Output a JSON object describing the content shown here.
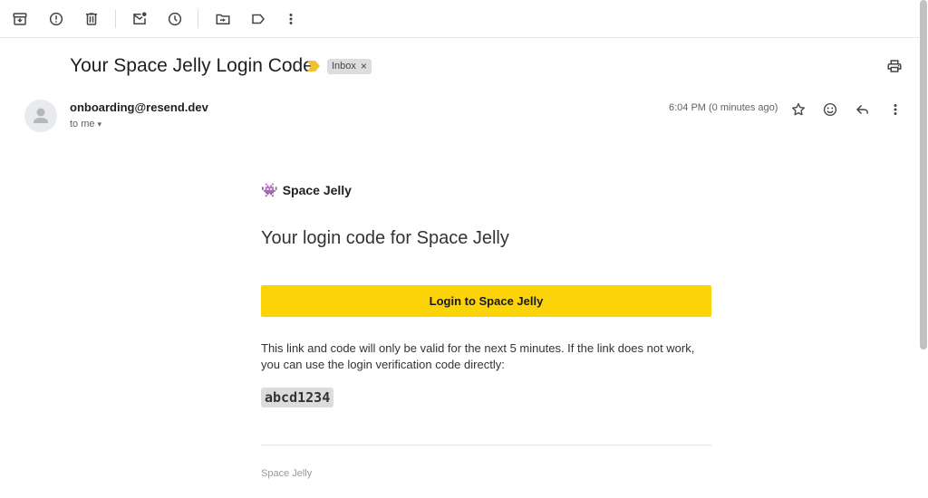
{
  "subject": "Your Space Jelly Login Code",
  "label": "Inbox",
  "label_close": "×",
  "sender": "onboarding@resend.dev",
  "recipient": "to me",
  "recipient_caret": "▾",
  "timestamp": "6:04 PM (0 minutes ago)",
  "email": {
    "brand_emoji": "👾",
    "brand": "Space Jelly",
    "heading": "Your login code for Space Jelly",
    "button_label": "Login to Space Jelly",
    "body": "This link and code will only be valid for the next 5 minutes. If the link does not work, you can use the login verification code directly:",
    "code": "abcd1234",
    "footer": "Space Jelly"
  },
  "colors": {
    "button": "#fcd307",
    "importance_marker": "#f2c12e",
    "label_chip": "#dddddd"
  }
}
